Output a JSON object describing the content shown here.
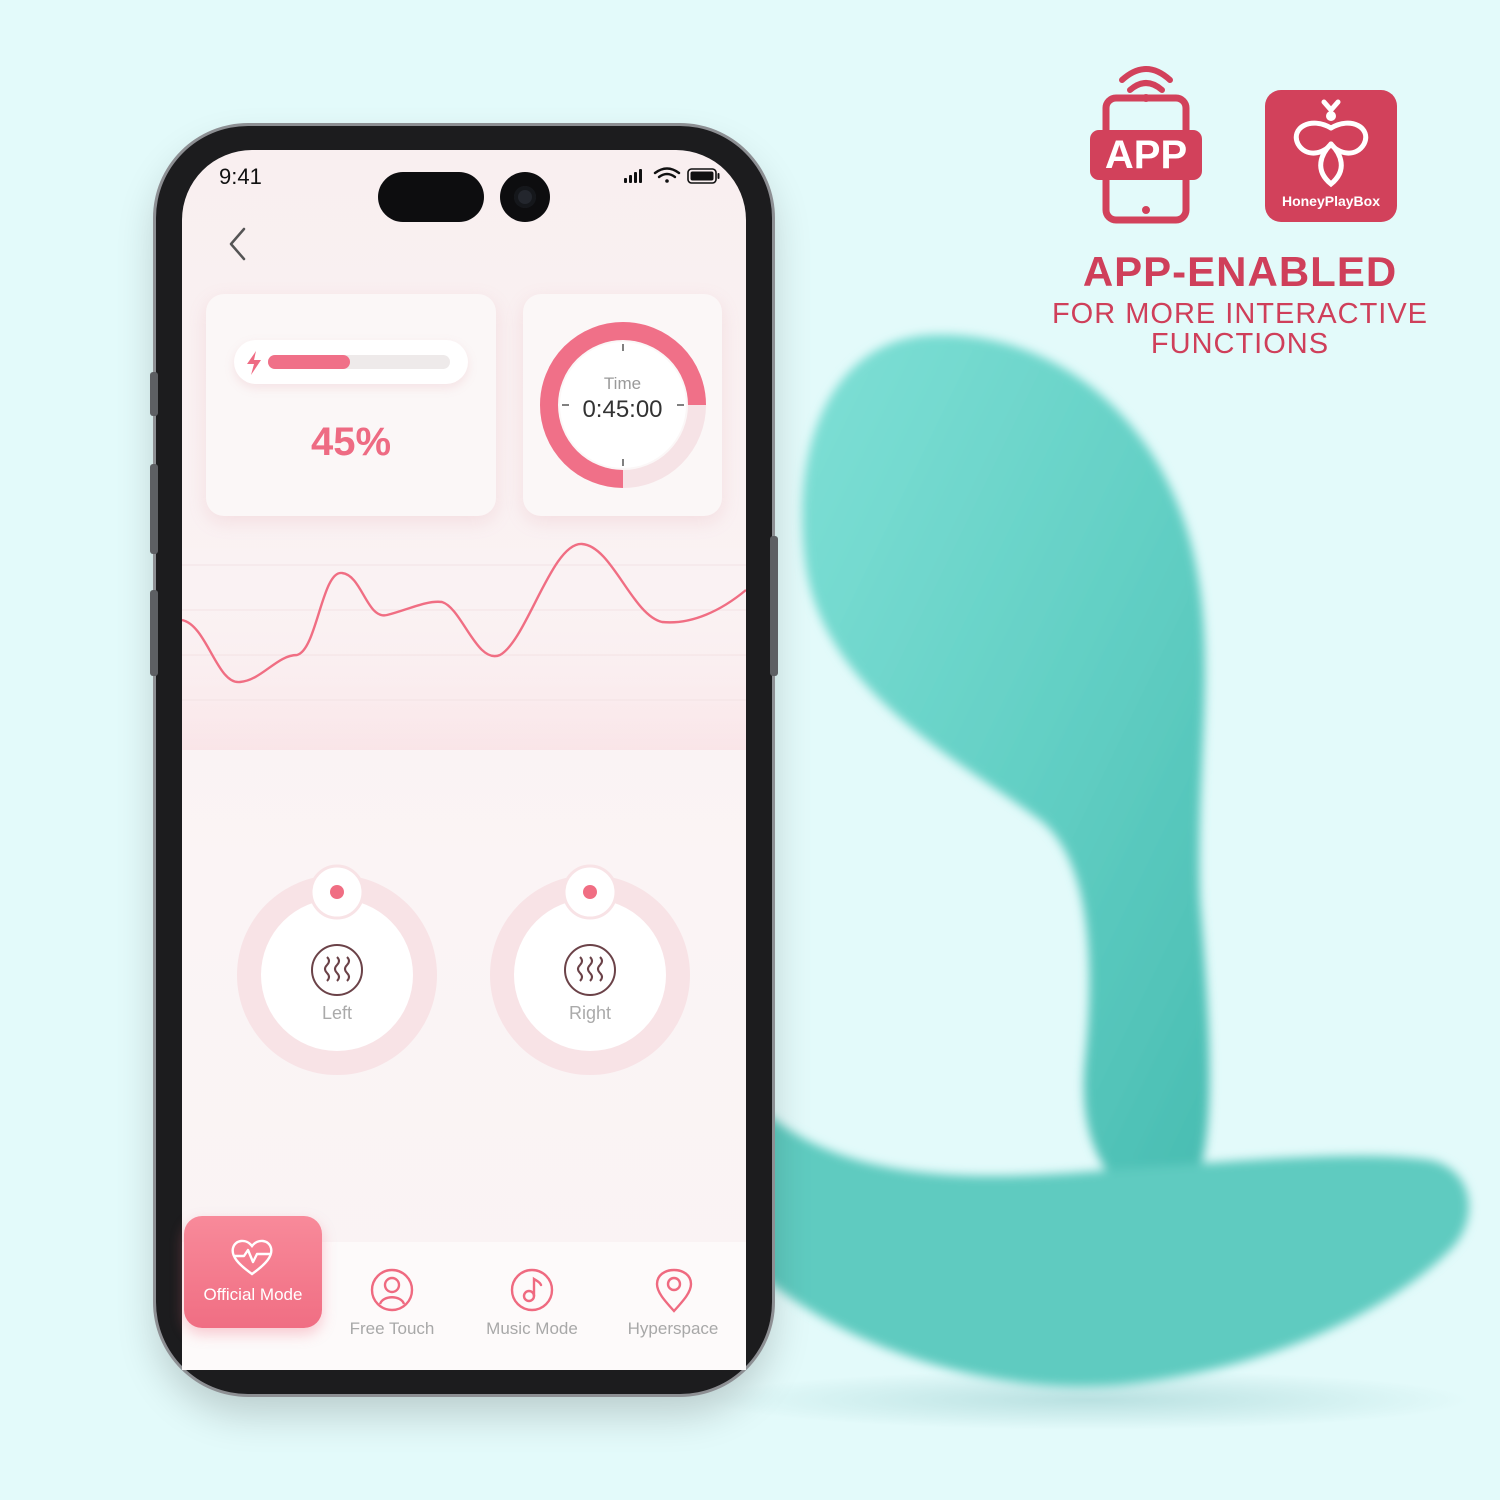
{
  "status_bar": {
    "time": "9:41"
  },
  "battery": {
    "level_percent": 45,
    "label": "45%"
  },
  "timer": {
    "label": "Time",
    "value": "0:45:00",
    "progress_fraction": 0.75
  },
  "motors": [
    {
      "label": "Left"
    },
    {
      "label": "Right"
    }
  ],
  "nav": {
    "items": [
      {
        "label": "Official Mode",
        "active": true,
        "icon": "heartbeat-icon"
      },
      {
        "label": "Free Touch",
        "active": false,
        "icon": "user-icon"
      },
      {
        "label": "Music Mode",
        "active": false,
        "icon": "music-note-icon"
      },
      {
        "label": "Hyperspace",
        "active": false,
        "icon": "location-pin-icon"
      }
    ]
  },
  "promo": {
    "app_badge": "APP",
    "brand_name": "HoneyPlayBox",
    "headline": "APP-ENABLED",
    "subline_1": "FOR MORE INTERACTIVE",
    "subline_2": "FUNCTIONS"
  },
  "colors": {
    "accent": "#ee6b83",
    "brand": "#d2415b",
    "background": "#e3fafa",
    "product": "#6fd6cb"
  }
}
